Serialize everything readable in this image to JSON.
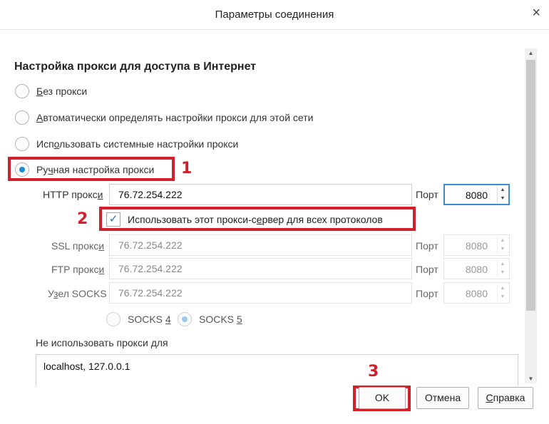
{
  "dialog": {
    "title": "Параметры соединения",
    "close_glyph": "×"
  },
  "section_heading": "Настройка прокси для доступа в Интернет",
  "proxy_options": [
    {
      "pre": "",
      "key": "Б",
      "post": "ез прокси",
      "checked": false
    },
    {
      "pre": "",
      "key": "А",
      "post": "втоматически определять настройки прокси для этой сети",
      "checked": false
    },
    {
      "pre": "Исп",
      "key": "о",
      "post": "льзовать системные настройки прокси",
      "checked": false
    },
    {
      "pre": "Ру",
      "key": "ч",
      "post": "ная настройка прокси",
      "checked": true
    }
  ],
  "manual": {
    "http_label_pre": "HTTP прокс",
    "http_label_key": "и",
    "http_value": "76.72.254.222",
    "port_label": "Порт",
    "http_port": "8080",
    "use_for_all_label_pre": "Использовать этот прокси-с",
    "use_for_all_label_key": "е",
    "use_for_all_label_post": "рвер для всех протоколов",
    "use_for_all_checked": true,
    "ssl_label_pre": "SSL прокс",
    "ssl_label_key": "и",
    "ssl_value": "76.72.254.222",
    "ssl_port": "8080",
    "ftp_label_pre": "FTP прокс",
    "ftp_label_key": "и",
    "ftp_value": "76.72.254.222",
    "ftp_port": "8080",
    "socks_label_pre": "У",
    "socks_label_key": "з",
    "socks_label_post": "ел SOCKS",
    "socks_value": "76.72.254.222",
    "socks_port": "8080",
    "socks4_label_pre": "SOCKS ",
    "socks4_label_key": "4",
    "socks5_label_pre": "SOCKS ",
    "socks5_label_key": "5",
    "socks_version_selected": "5"
  },
  "no_proxy": {
    "label_pre": "Не использовать прокси ",
    "label_key": "д",
    "label_post": "ля",
    "value": "localhost, 127.0.0.1"
  },
  "buttons": {
    "ok": "OK",
    "cancel": "Отмена",
    "help_key": "С",
    "help_post": "правка"
  },
  "annotations": {
    "step1": "1",
    "step2": "2",
    "step3": "3",
    "color": "#d21f2a"
  },
  "scroll_arrows": {
    "up": "▲",
    "down": "▼"
  },
  "spinner_glyphs": {
    "up": "▲",
    "down": "▼"
  },
  "check_glyph": "✓",
  "colors": {
    "accent": "#1a8fd6",
    "focus_border": "#3b8fd8"
  }
}
